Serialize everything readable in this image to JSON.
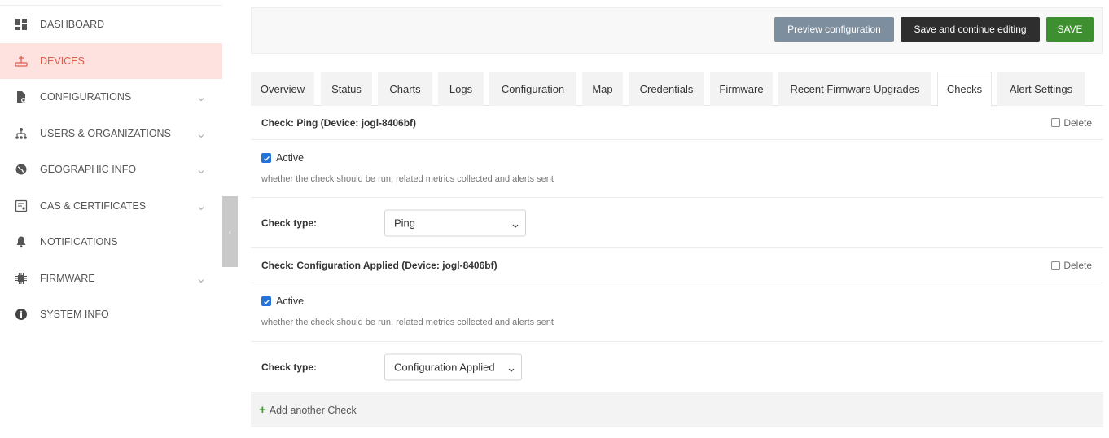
{
  "sidebar": {
    "items": [
      {
        "label": "DASHBOARD",
        "icon": "dashboard-icon",
        "chevron": false
      },
      {
        "label": "DEVICES",
        "icon": "router-icon",
        "chevron": false,
        "active": true
      },
      {
        "label": "CONFIGURATIONS",
        "icon": "document-gear-icon",
        "chevron": true
      },
      {
        "label": "USERS & ORGANIZATIONS",
        "icon": "org-chart-icon",
        "chevron": true
      },
      {
        "label": "GEOGRAPHIC INFO",
        "icon": "globe-icon",
        "chevron": true
      },
      {
        "label": "CAS & CERTIFICATES",
        "icon": "certificate-icon",
        "chevron": true
      },
      {
        "label": "NOTIFICATIONS",
        "icon": "bell-icon",
        "chevron": false
      },
      {
        "label": "FIRMWARE",
        "icon": "chip-icon",
        "chevron": true
      },
      {
        "label": "SYSTEM INFO",
        "icon": "info-icon",
        "chevron": false
      }
    ],
    "toggle_glyph": "‹"
  },
  "toolbar": {
    "preview_label": "Preview configuration",
    "continue_label": "Save and continue editing",
    "save_label": "SAVE"
  },
  "tabs": [
    {
      "label": "Overview"
    },
    {
      "label": "Status"
    },
    {
      "label": "Charts"
    },
    {
      "label": "Logs"
    },
    {
      "label": "Configuration"
    },
    {
      "label": "Map"
    },
    {
      "label": "Credentials"
    },
    {
      "label": "Firmware"
    },
    {
      "label": "Recent Firmware Upgrades"
    },
    {
      "label": "Checks",
      "active": true
    },
    {
      "label": "Alert Settings"
    }
  ],
  "checks": [
    {
      "title": "Check: Ping (Device: jogl-8406bf)",
      "delete_label": "Delete",
      "active_label": "Active",
      "active_checked": true,
      "help_text": "whether the check should be run, related metrics collected and alerts sent",
      "type_label": "Check type:",
      "type_value": "Ping"
    },
    {
      "title": "Check: Configuration Applied (Device: jogl-8406bf)",
      "delete_label": "Delete",
      "active_label": "Active",
      "active_checked": true,
      "help_text": "whether the check should be run, related metrics collected and alerts sent",
      "type_label": "Check type:",
      "type_value": "Configuration Applied"
    }
  ],
  "add_label": "Add another Check",
  "colors": {
    "accent": "#df5d4f",
    "active_bg": "#fde2e0",
    "save_green": "#3e8f2f",
    "checkbox_blue": "#2473d6"
  }
}
